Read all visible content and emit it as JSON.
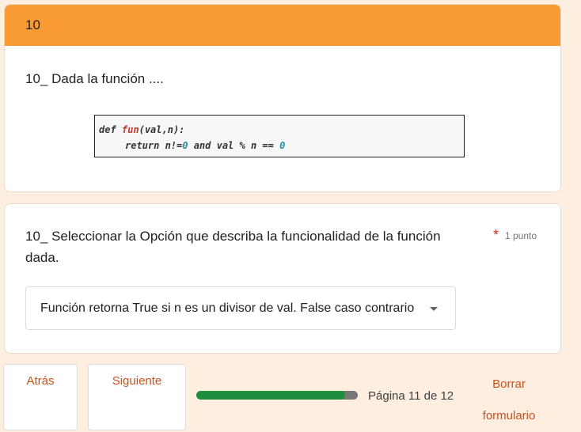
{
  "section": {
    "header_title": "10",
    "title": "10_  Dada la función  ....",
    "code": {
      "line1": {
        "def": "def ",
        "name": "fun",
        "args": "(val,n):"
      },
      "line2": {
        "ret": "return n!=",
        "zero1": "0",
        "mid": " and val % n == ",
        "zero2": "0"
      }
    }
  },
  "question": {
    "title": "10_ Seleccionar la Opción que describa  la funcionalidad de la función dada.",
    "required_mark": "*",
    "points": "1 punto",
    "selected_option": "Función retorna True si n es un divisor de val. False caso contrario"
  },
  "navigation": {
    "back_label": "Atrás",
    "next_label": "Siguiente",
    "progress_fraction": 0.92,
    "page_label": "Página 11 de 12",
    "clear_label_line1": "Borrar",
    "clear_label_line2": "formulario"
  },
  "colors": {
    "header": "#f89b35",
    "accent": "#c9521d",
    "progress": "#1e8e3e",
    "background": "#fdeee0"
  }
}
